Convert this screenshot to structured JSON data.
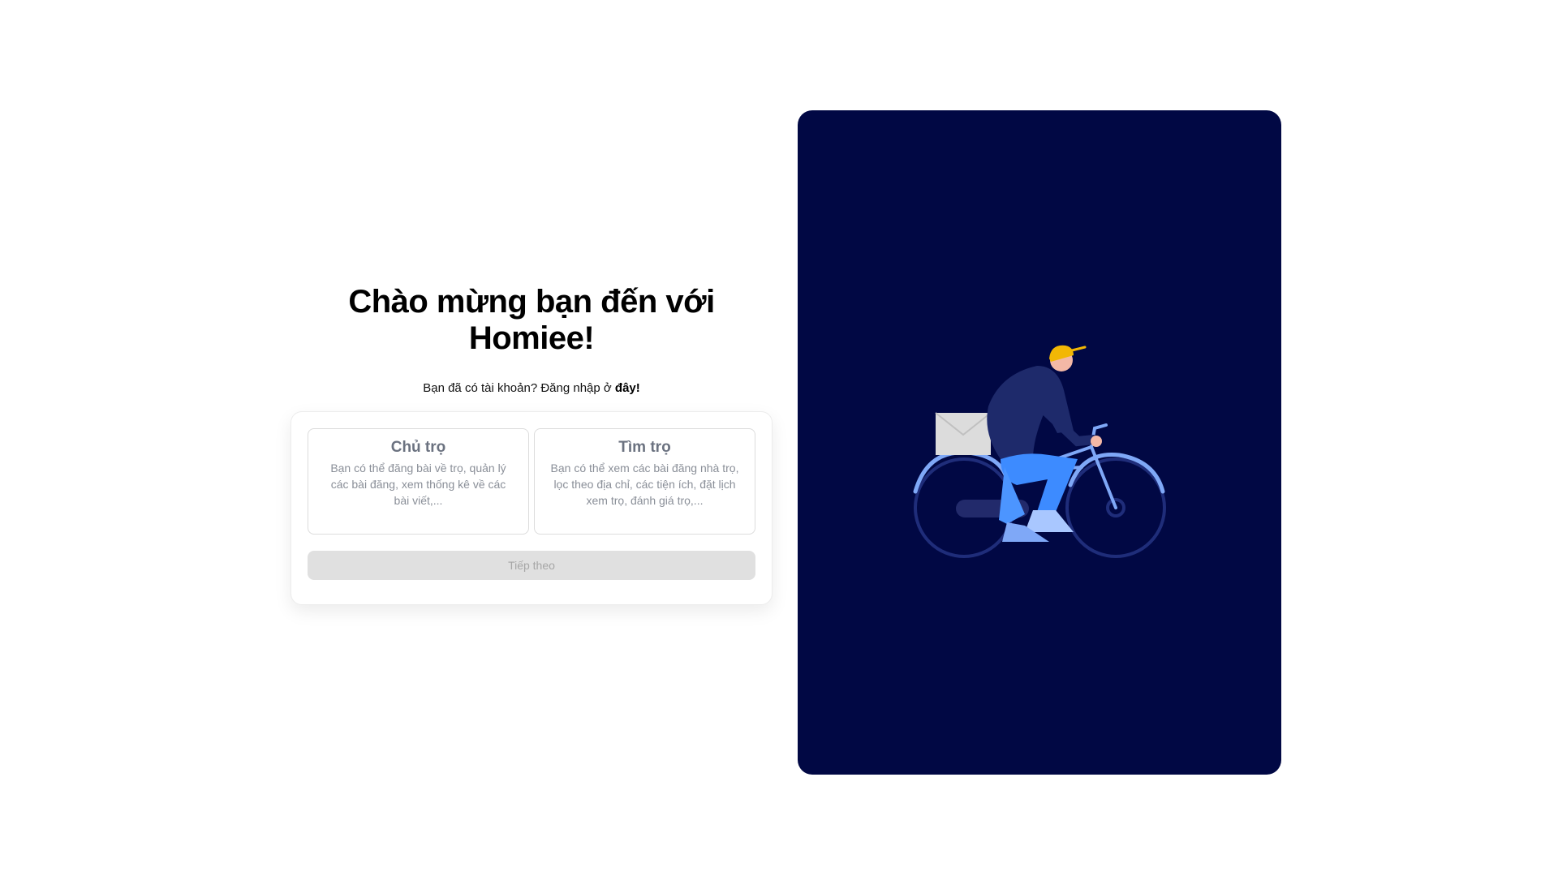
{
  "welcome": {
    "title": "Chào mừng bạn đến với Homiee!",
    "login_prompt": "Bạn đã có tài khoản? Đăng nhập ở ",
    "login_link": "đây!"
  },
  "roles": [
    {
      "title": "Chủ trọ",
      "description": "Bạn có thể đăng bài về trọ, quản lý các bài đăng, xem thống kê về các bài viết,..."
    },
    {
      "title": "Tìm trọ",
      "description": "Bạn có thể xem các bài đăng nhà trọ, lọc theo địa chỉ, các tiện ích, đặt lịch xem trọ, đánh giá trọ,..."
    }
  ],
  "next_button": {
    "label": "Tiếp theo"
  },
  "colors": {
    "panel_background": "#010844",
    "button_disabled": "#e0e0e0",
    "helmet": "#f2b705",
    "rider_jacket": "#1e2a6b",
    "rider_pants": "#3d8bff",
    "bicycle": "#7fa8f7"
  },
  "icons": {
    "illustration": "delivery-cyclist-illustration"
  }
}
